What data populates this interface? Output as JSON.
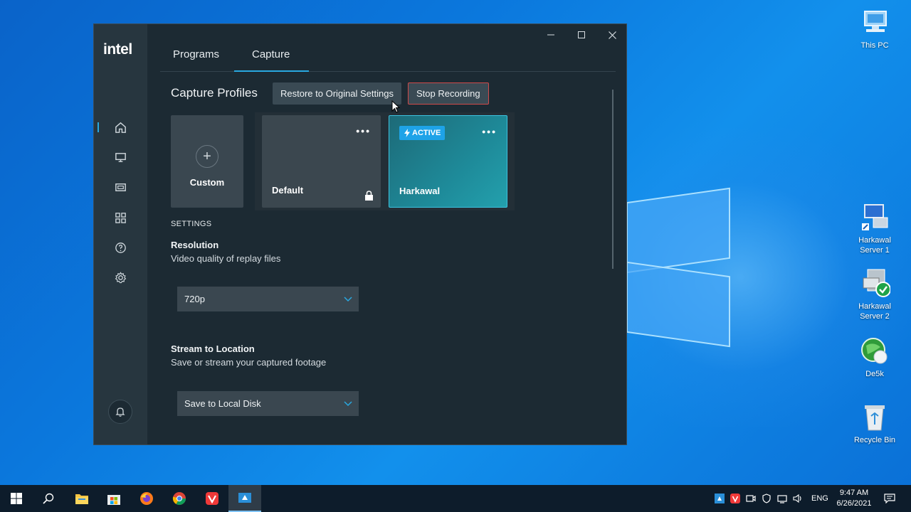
{
  "app": {
    "logo": "intel",
    "tabs": [
      {
        "label": "Programs"
      },
      {
        "label": "Capture"
      }
    ],
    "section_title": "Capture Profiles",
    "restore_button": "Restore to Original Settings",
    "stop_button": "Stop Recording",
    "profiles": [
      {
        "label": "Custom"
      },
      {
        "label": "Default"
      },
      {
        "label": "Harkawal",
        "badge": "ACTIVE"
      }
    ],
    "settings_heading": "SETTINGS",
    "resolution": {
      "title": "Resolution",
      "description": "Video quality of replay files",
      "value": "720p"
    },
    "stream": {
      "title": "Stream to Location",
      "description": "Save or stream your captured footage",
      "value": "Save to Local Disk"
    },
    "colors": {
      "accent": "#29a8e0",
      "stop_border": "#d04a4a",
      "active_card": "#1e8a99"
    }
  },
  "desktop": {
    "icons": [
      {
        "label": "This PC"
      },
      {
        "label": "Harkawal Server 1"
      },
      {
        "label": "Harkawal Server 2"
      },
      {
        "label": "De5k"
      },
      {
        "label": "Recycle Bin"
      }
    ]
  },
  "taskbar": {
    "tray_lang": "ENG",
    "time": "9:47 AM",
    "date": "6/26/2021"
  }
}
